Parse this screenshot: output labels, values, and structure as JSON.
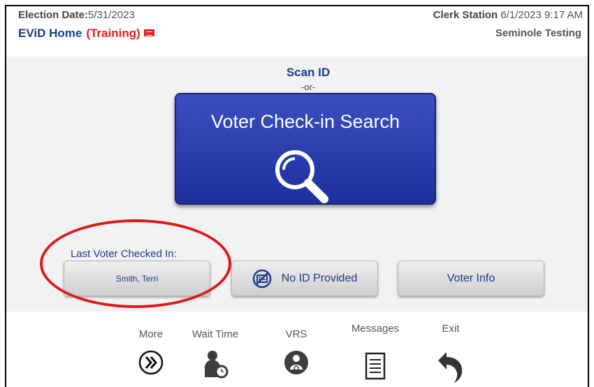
{
  "header": {
    "election_date_label": "Election Date:",
    "election_date_value": "5/31/2023",
    "home_title": "EViD Home",
    "training_label": "(Training)",
    "clerk_station_label": "Clerk Station",
    "clerk_station_datetime": "6/1/2023 9:17 AM",
    "location": "Seminole Testing"
  },
  "main": {
    "scan_id": "Scan ID",
    "or_text": "-or-",
    "search_button_label": "Voter Check-in Search",
    "last_voter_label": "Last Voter Checked In:",
    "last_voter_name": "Smith, Terri",
    "no_id_label": "No ID Provided",
    "voter_info_label": "Voter Info"
  },
  "nav": {
    "more": "More",
    "wait_time": "Wait Time",
    "vrs": "VRS",
    "messages": "Messages",
    "exit": "Exit"
  },
  "colors": {
    "accent_blue": "#1a3a8c",
    "button_blue": "#2a3db0",
    "training_red": "#e02020",
    "annotation_red": "#e01818"
  },
  "icons": [
    "flag-icon",
    "magnifier-icon",
    "no-id-card-icon",
    "double-chevron-right-icon",
    "person-clock-icon",
    "person-sync-icon",
    "document-lines-icon",
    "return-arrow-icon"
  ]
}
